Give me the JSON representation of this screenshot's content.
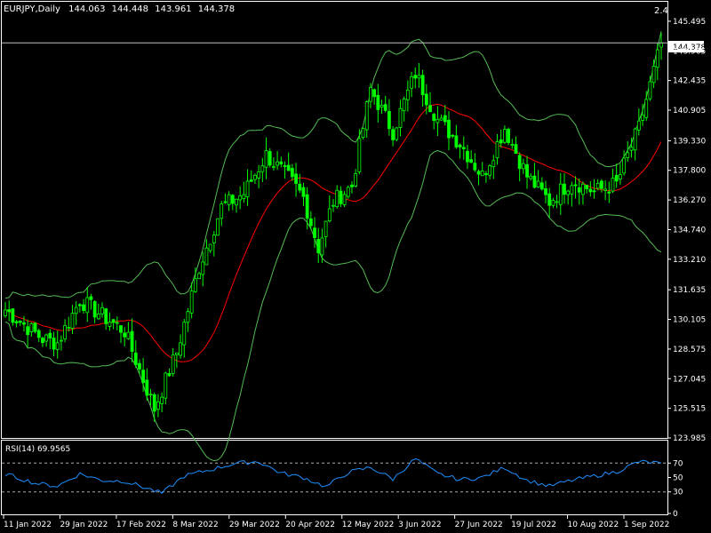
{
  "header": {
    "symbol": "EURJPY,Daily",
    "open": "144.063",
    "high": "144.448",
    "low": "143.961",
    "close": "144.378",
    "corner_value": "2.4"
  },
  "price_tag": "144.378",
  "rsi_label": "RSI(14) 69.9565",
  "colors": {
    "background": "#000000",
    "frame": "#ffffff",
    "bull": "#00ff00",
    "bear": "#00ff00",
    "bollinger": "#55bb55",
    "ma": "#ff0000",
    "rsi": "#1e90ff",
    "levels": "#aaaaaa"
  },
  "chart_data": {
    "type": "candlestick",
    "price_axis": {
      "min": 123.985,
      "max": 146.5,
      "ticks": [
        "145.495",
        "143.965",
        "142.435",
        "140.905",
        "139.330",
        "137.800",
        "136.270",
        "134.740",
        "133.210",
        "131.635",
        "130.105",
        "128.575",
        "127.045",
        "125.515",
        "123.985"
      ]
    },
    "rsi_axis": {
      "min": 0,
      "max": 100,
      "ticks": [
        "70",
        "50",
        "30",
        "0"
      ],
      "levels": [
        70,
        30
      ]
    },
    "date_labels": [
      "11 Jan 2022",
      "29 Jan 2022",
      "17 Feb 2022",
      "8 Mar 2022",
      "29 Mar 2022",
      "20 Apr 2022",
      "12 May 2022",
      "3 Jun 2022",
      "27 Jun 2022",
      "19 Jul 2022",
      "10 Aug 2022",
      "1 Sep 2022"
    ],
    "close_anchors": [
      [
        0,
        130.6
      ],
      [
        10,
        129.1
      ],
      [
        14,
        128.9
      ],
      [
        20,
        131.1
      ],
      [
        26,
        130.3
      ],
      [
        32,
        129.5
      ],
      [
        40,
        125.5
      ],
      [
        46,
        128.4
      ],
      [
        52,
        132.8
      ],
      [
        58,
        135.9
      ],
      [
        64,
        136.6
      ],
      [
        70,
        138.6
      ],
      [
        76,
        137.4
      ],
      [
        80,
        136.4
      ],
      [
        84,
        133.8
      ],
      [
        88,
        136.2
      ],
      [
        93,
        137.0
      ],
      [
        98,
        142.0
      ],
      [
        104,
        139.8
      ],
      [
        110,
        142.8
      ],
      [
        116,
        140.4
      ],
      [
        122,
        139.2
      ],
      [
        128,
        137.5
      ],
      [
        134,
        140.0
      ],
      [
        140,
        137.5
      ],
      [
        146,
        136.2
      ],
      [
        152,
        137.3
      ],
      [
        158,
        136.7
      ],
      [
        164,
        137.1
      ],
      [
        170,
        140.0
      ],
      [
        176,
        144.38
      ]
    ],
    "rsi_anchors": [
      [
        0,
        55
      ],
      [
        8,
        42
      ],
      [
        14,
        38
      ],
      [
        20,
        55
      ],
      [
        26,
        46
      ],
      [
        32,
        45
      ],
      [
        38,
        35
      ],
      [
        42,
        28
      ],
      [
        48,
        52
      ],
      [
        56,
        62
      ],
      [
        62,
        70
      ],
      [
        68,
        72
      ],
      [
        74,
        56
      ],
      [
        80,
        50
      ],
      [
        86,
        37
      ],
      [
        92,
        57
      ],
      [
        98,
        64
      ],
      [
        104,
        48
      ],
      [
        110,
        76
      ],
      [
        116,
        55
      ],
      [
        122,
        47
      ],
      [
        128,
        50
      ],
      [
        134,
        64
      ],
      [
        140,
        46
      ],
      [
        146,
        38
      ],
      [
        152,
        46
      ],
      [
        158,
        52
      ],
      [
        164,
        58
      ],
      [
        170,
        72
      ],
      [
        176,
        70
      ]
    ],
    "last_rsi": 69.9565
  }
}
